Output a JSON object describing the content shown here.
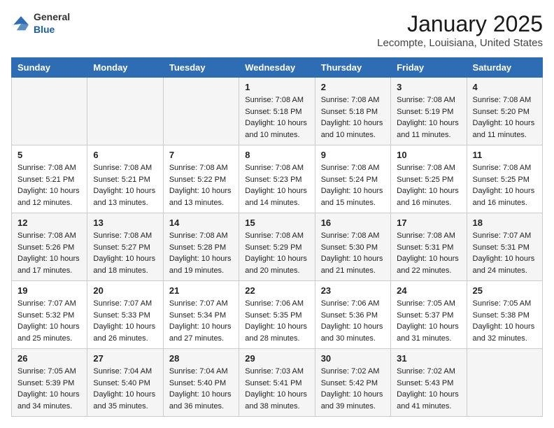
{
  "header": {
    "logo_general": "General",
    "logo_blue": "Blue",
    "title": "January 2025",
    "subtitle": "Lecompte, Louisiana, United States"
  },
  "days_of_week": [
    "Sunday",
    "Monday",
    "Tuesday",
    "Wednesday",
    "Thursday",
    "Friday",
    "Saturday"
  ],
  "weeks": [
    [
      {
        "day": "",
        "sunrise": "",
        "sunset": "",
        "daylight": ""
      },
      {
        "day": "",
        "sunrise": "",
        "sunset": "",
        "daylight": ""
      },
      {
        "day": "",
        "sunrise": "",
        "sunset": "",
        "daylight": ""
      },
      {
        "day": "1",
        "sunrise": "Sunrise: 7:08 AM",
        "sunset": "Sunset: 5:18 PM",
        "daylight": "Daylight: 10 hours and 10 minutes."
      },
      {
        "day": "2",
        "sunrise": "Sunrise: 7:08 AM",
        "sunset": "Sunset: 5:18 PM",
        "daylight": "Daylight: 10 hours and 10 minutes."
      },
      {
        "day": "3",
        "sunrise": "Sunrise: 7:08 AM",
        "sunset": "Sunset: 5:19 PM",
        "daylight": "Daylight: 10 hours and 11 minutes."
      },
      {
        "day": "4",
        "sunrise": "Sunrise: 7:08 AM",
        "sunset": "Sunset: 5:20 PM",
        "daylight": "Daylight: 10 hours and 11 minutes."
      }
    ],
    [
      {
        "day": "5",
        "sunrise": "Sunrise: 7:08 AM",
        "sunset": "Sunset: 5:21 PM",
        "daylight": "Daylight: 10 hours and 12 minutes."
      },
      {
        "day": "6",
        "sunrise": "Sunrise: 7:08 AM",
        "sunset": "Sunset: 5:21 PM",
        "daylight": "Daylight: 10 hours and 13 minutes."
      },
      {
        "day": "7",
        "sunrise": "Sunrise: 7:08 AM",
        "sunset": "Sunset: 5:22 PM",
        "daylight": "Daylight: 10 hours and 13 minutes."
      },
      {
        "day": "8",
        "sunrise": "Sunrise: 7:08 AM",
        "sunset": "Sunset: 5:23 PM",
        "daylight": "Daylight: 10 hours and 14 minutes."
      },
      {
        "day": "9",
        "sunrise": "Sunrise: 7:08 AM",
        "sunset": "Sunset: 5:24 PM",
        "daylight": "Daylight: 10 hours and 15 minutes."
      },
      {
        "day": "10",
        "sunrise": "Sunrise: 7:08 AM",
        "sunset": "Sunset: 5:25 PM",
        "daylight": "Daylight: 10 hours and 16 minutes."
      },
      {
        "day": "11",
        "sunrise": "Sunrise: 7:08 AM",
        "sunset": "Sunset: 5:25 PM",
        "daylight": "Daylight: 10 hours and 16 minutes."
      }
    ],
    [
      {
        "day": "12",
        "sunrise": "Sunrise: 7:08 AM",
        "sunset": "Sunset: 5:26 PM",
        "daylight": "Daylight: 10 hours and 17 minutes."
      },
      {
        "day": "13",
        "sunrise": "Sunrise: 7:08 AM",
        "sunset": "Sunset: 5:27 PM",
        "daylight": "Daylight: 10 hours and 18 minutes."
      },
      {
        "day": "14",
        "sunrise": "Sunrise: 7:08 AM",
        "sunset": "Sunset: 5:28 PM",
        "daylight": "Daylight: 10 hours and 19 minutes."
      },
      {
        "day": "15",
        "sunrise": "Sunrise: 7:08 AM",
        "sunset": "Sunset: 5:29 PM",
        "daylight": "Daylight: 10 hours and 20 minutes."
      },
      {
        "day": "16",
        "sunrise": "Sunrise: 7:08 AM",
        "sunset": "Sunset: 5:30 PM",
        "daylight": "Daylight: 10 hours and 21 minutes."
      },
      {
        "day": "17",
        "sunrise": "Sunrise: 7:08 AM",
        "sunset": "Sunset: 5:31 PM",
        "daylight": "Daylight: 10 hours and 22 minutes."
      },
      {
        "day": "18",
        "sunrise": "Sunrise: 7:07 AM",
        "sunset": "Sunset: 5:31 PM",
        "daylight": "Daylight: 10 hours and 24 minutes."
      }
    ],
    [
      {
        "day": "19",
        "sunrise": "Sunrise: 7:07 AM",
        "sunset": "Sunset: 5:32 PM",
        "daylight": "Daylight: 10 hours and 25 minutes."
      },
      {
        "day": "20",
        "sunrise": "Sunrise: 7:07 AM",
        "sunset": "Sunset: 5:33 PM",
        "daylight": "Daylight: 10 hours and 26 minutes."
      },
      {
        "day": "21",
        "sunrise": "Sunrise: 7:07 AM",
        "sunset": "Sunset: 5:34 PM",
        "daylight": "Daylight: 10 hours and 27 minutes."
      },
      {
        "day": "22",
        "sunrise": "Sunrise: 7:06 AM",
        "sunset": "Sunset: 5:35 PM",
        "daylight": "Daylight: 10 hours and 28 minutes."
      },
      {
        "day": "23",
        "sunrise": "Sunrise: 7:06 AM",
        "sunset": "Sunset: 5:36 PM",
        "daylight": "Daylight: 10 hours and 30 minutes."
      },
      {
        "day": "24",
        "sunrise": "Sunrise: 7:05 AM",
        "sunset": "Sunset: 5:37 PM",
        "daylight": "Daylight: 10 hours and 31 minutes."
      },
      {
        "day": "25",
        "sunrise": "Sunrise: 7:05 AM",
        "sunset": "Sunset: 5:38 PM",
        "daylight": "Daylight: 10 hours and 32 minutes."
      }
    ],
    [
      {
        "day": "26",
        "sunrise": "Sunrise: 7:05 AM",
        "sunset": "Sunset: 5:39 PM",
        "daylight": "Daylight: 10 hours and 34 minutes."
      },
      {
        "day": "27",
        "sunrise": "Sunrise: 7:04 AM",
        "sunset": "Sunset: 5:40 PM",
        "daylight": "Daylight: 10 hours and 35 minutes."
      },
      {
        "day": "28",
        "sunrise": "Sunrise: 7:04 AM",
        "sunset": "Sunset: 5:40 PM",
        "daylight": "Daylight: 10 hours and 36 minutes."
      },
      {
        "day": "29",
        "sunrise": "Sunrise: 7:03 AM",
        "sunset": "Sunset: 5:41 PM",
        "daylight": "Daylight: 10 hours and 38 minutes."
      },
      {
        "day": "30",
        "sunrise": "Sunrise: 7:02 AM",
        "sunset": "Sunset: 5:42 PM",
        "daylight": "Daylight: 10 hours and 39 minutes."
      },
      {
        "day": "31",
        "sunrise": "Sunrise: 7:02 AM",
        "sunset": "Sunset: 5:43 PM",
        "daylight": "Daylight: 10 hours and 41 minutes."
      },
      {
        "day": "",
        "sunrise": "",
        "sunset": "",
        "daylight": ""
      }
    ]
  ]
}
